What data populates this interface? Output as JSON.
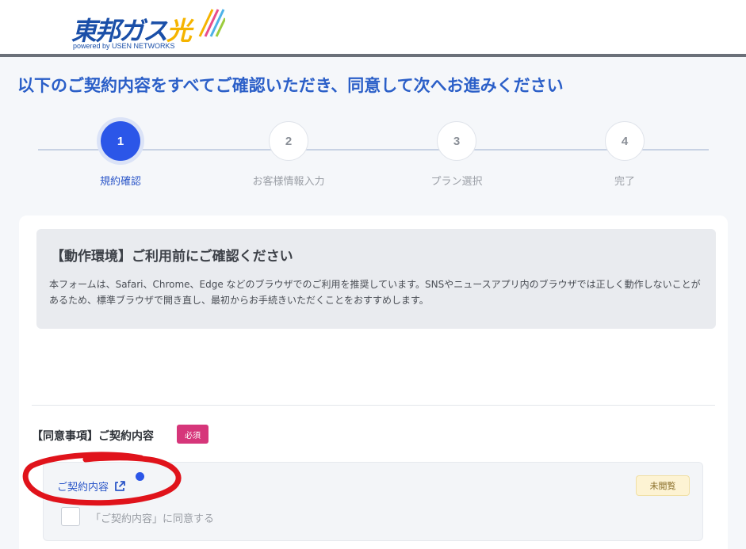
{
  "header": {
    "logo_text": "東邦ガス",
    "logo_accent": "光",
    "logo_sub": "powered by USEN NETWORKS"
  },
  "page": {
    "title": "以下のご契約内容をすべてご確認いただき、同意して次へお進みください"
  },
  "steps": [
    {
      "number": "1",
      "label": "規約確認",
      "active": true
    },
    {
      "number": "2",
      "label": "お客様情報入力",
      "active": false
    },
    {
      "number": "3",
      "label": "プラン選択",
      "active": false
    },
    {
      "number": "4",
      "label": "完了",
      "active": false
    }
  ],
  "notice": {
    "title": "【動作環境】ご利用前にご確認ください",
    "body": "本フォームは、Safari、Chrome、Edge などのブラウザでのご利用を推奨しています。SNSやニュースアプリ内のブラウザでは正しく動作しないことがあるため、標準ブラウザで開き直し、最初からお手続きいただくことをおすすめします。"
  },
  "agreement": {
    "heading": "【同意事項】ご契約内容",
    "required_badge": "必須",
    "link_label": "ご契約内容",
    "link_icon": "external-link-icon",
    "status_badge": "未閲覧",
    "checkbox_label": "「ご契約内容」に同意する",
    "checked": false
  },
  "colors": {
    "brand_blue": "#2b56e8",
    "title_blue": "#2b5fc8",
    "required_pink": "#d6367a",
    "unread_bg": "#fdf3d3",
    "annotation_red": "#e0131b"
  }
}
